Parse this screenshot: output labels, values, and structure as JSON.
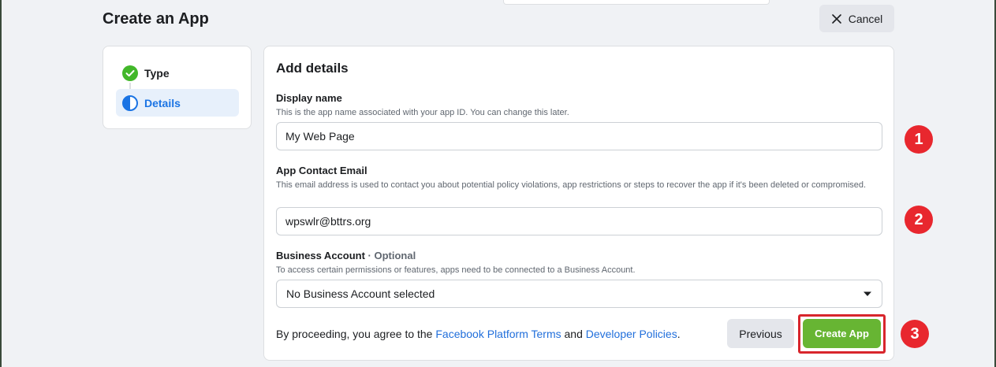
{
  "header": {
    "title": "Create an App",
    "cancel_label": "Cancel"
  },
  "steps": [
    {
      "label": "Type",
      "state": "complete"
    },
    {
      "label": "Details",
      "state": "active"
    }
  ],
  "form": {
    "title": "Add details",
    "display_name": {
      "label": "Display name",
      "help": "This is the app name associated with your app ID. You can change this later.",
      "value": "My Web Page"
    },
    "contact_email": {
      "label": "App Contact Email",
      "help": "This email address is used to contact you about potential policy violations, app restrictions or steps to recover the app if it's been deleted or compromised.",
      "value": "wpswlr@bttrs.org"
    },
    "business_account": {
      "label": "Business Account",
      "optional": " · Optional",
      "help": "To access certain permissions or features, apps need to be connected to a Business Account.",
      "selected": "No Business Account selected"
    },
    "terms": {
      "prefix": "By proceeding, you agree to the ",
      "link1": "Facebook Platform Terms",
      "middle": " and ",
      "link2": "Developer Policies",
      "suffix": "."
    },
    "previous_label": "Previous",
    "create_label": "Create App"
  },
  "callouts": [
    "1",
    "2",
    "3"
  ],
  "colors": {
    "accent_blue": "#1b74e4",
    "link_blue": "#216fdb",
    "success_green": "#67b533",
    "callout_red": "#e8272e",
    "highlight_red": "#d8262c"
  }
}
